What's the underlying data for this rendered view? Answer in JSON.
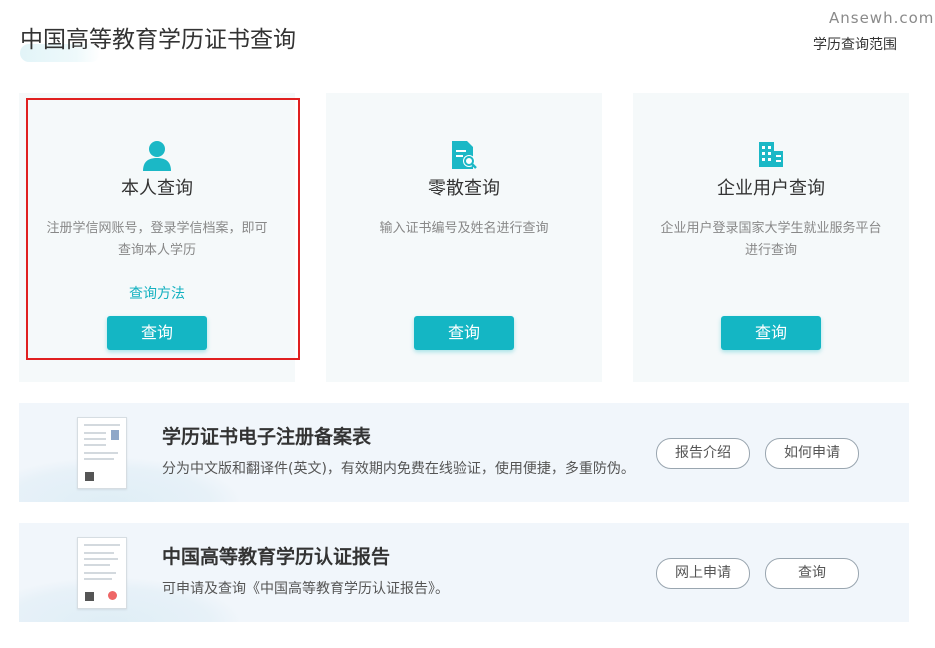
{
  "watermark": "Ansewh.com",
  "header": {
    "title": "中国高等教育学历证书查询",
    "scope_link": "学历查询范围"
  },
  "cards": [
    {
      "title": "本人查询",
      "desc": "注册学信网账号，登录学信档案，即可查询本人学历",
      "link": "查询方法",
      "button": "查询",
      "icon": "person-icon"
    },
    {
      "title": "零散查询",
      "desc": "输入证书编号及姓名进行查询",
      "button": "查询",
      "icon": "document-search-icon"
    },
    {
      "title": "企业用户查询",
      "desc": "企业用户登录国家大学生就业服务平台进行查询",
      "button": "查询",
      "icon": "building-icon"
    }
  ],
  "banners": [
    {
      "title": "学历证书电子注册备案表",
      "desc": "分为中文版和翻译件(英文)，有效期内免费在线验证，使用便捷，多重防伪。",
      "btn1": "报告介绍",
      "btn2": "如何申请"
    },
    {
      "title": "中国高等教育学历认证报告",
      "desc": "可申请及查询《中国高等教育学历认证报告》。",
      "btn1": "网上申请",
      "btn2": "查询"
    }
  ],
  "colors": {
    "accent": "#14b6c4",
    "highlight": "#e02020",
    "card_bg": "#f5f9fa",
    "banner_bg": "#f1f6fb"
  }
}
